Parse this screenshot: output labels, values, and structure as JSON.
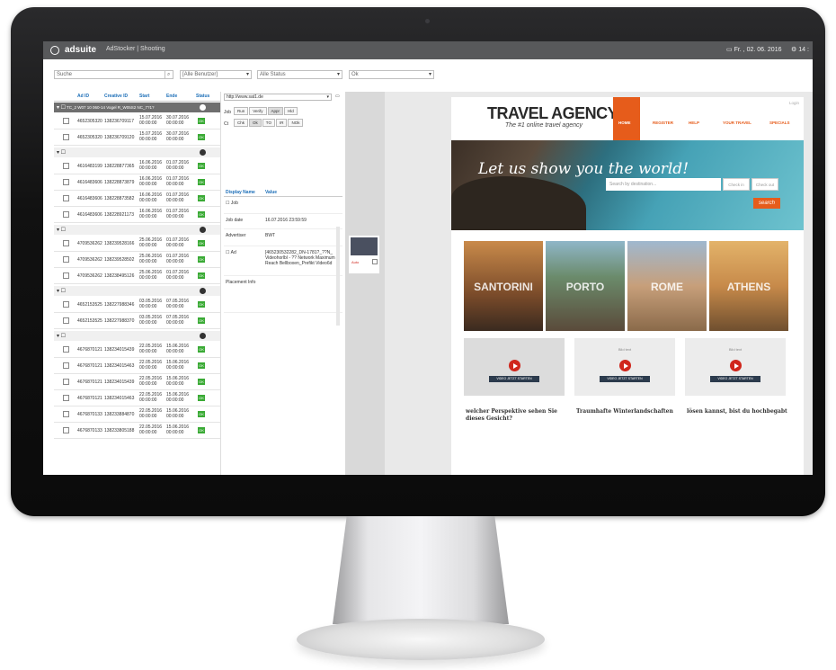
{
  "app": {
    "brand": "adsuite",
    "breadcrumb": "AdStocker | Shooting",
    "datetime": "Fr. , 02. 06. 2016",
    "user": "14 :"
  },
  "filters": {
    "search_placeholder": "Suche",
    "all_users": "[Alle Benutzer]",
    "all_status": "Alle Status",
    "ok_value": "Ok"
  },
  "grid": {
    "columns": [
      "Ad ID",
      "Creative ID",
      "Start",
      "Ende",
      "Status"
    ],
    "groups": [
      {
        "title": "TC_2 W07 10 060-14 Vogel R_W05S2 NC_7?1?",
        "dark": true,
        "rows": [
          {
            "ad": "4652305320",
            "creative": "138236709117",
            "start": "15.07.2016 00:00:00",
            "end": "30.07.2016 00:00:00",
            "status": "OK"
          },
          {
            "ad": "4652305320",
            "creative": "138236709120",
            "start": "15.07.2016 00:00:00",
            "end": "30.07.2016 00:00:00",
            "status": "OK"
          }
        ]
      },
      {
        "title": "",
        "dark": false,
        "rows": [
          {
            "ad": "4616483199",
            "creative": "138228877365",
            "start": "16.06.2016 00:00:00",
            "end": "01.07.2016 00:00:00",
            "status": "OK"
          },
          {
            "ad": "4616483606",
            "creative": "138228873879",
            "start": "16.06.2016 00:00:00",
            "end": "01.07.2016 00:00:00",
            "status": "OK"
          },
          {
            "ad": "4616483606",
            "creative": "138228873582",
            "start": "16.06.2016 00:00:00",
            "end": "01.07.2016 00:00:00",
            "status": "OK"
          },
          {
            "ad": "4616483606",
            "creative": "138228921173",
            "start": "16.06.2016 00:00:00",
            "end": "01.07.2016 00:00:00",
            "status": "OK"
          }
        ]
      },
      {
        "title": "",
        "dark": false,
        "rows": [
          {
            "ad": "4709536262",
            "creative": "138239528166",
            "start": "25.06.2016 00:00:00",
            "end": "01.07.2016 00:00:00",
            "status": "OK"
          },
          {
            "ad": "4709536262",
            "creative": "138239528502",
            "start": "25.06.2016 00:00:00",
            "end": "01.07.2016 00:00:00",
            "status": "OK"
          },
          {
            "ad": "4709536262",
            "creative": "138238495126",
            "start": "25.06.2016 00:00:00",
            "end": "01.07.2016 00:00:00",
            "status": "OK"
          }
        ]
      },
      {
        "title": "",
        "dark": false,
        "rows": [
          {
            "ad": "4652153525",
            "creative": "138227988346",
            "start": "03.05.2016 00:00:00",
            "end": "07.05.2016 00:00:00",
            "status": "OK"
          },
          {
            "ad": "4652153525",
            "creative": "138227988370",
            "start": "03.05.2016 00:00:00",
            "end": "07.05.2016 00:00:00",
            "status": "OK"
          }
        ]
      },
      {
        "title": "",
        "dark": false,
        "rows": [
          {
            "ad": "4676870121",
            "creative": "138234015439",
            "start": "22.05.2016 00:00:00",
            "end": "15.06.2016 00:00:00",
            "status": "OK"
          },
          {
            "ad": "4676870121",
            "creative": "138234015463",
            "start": "22.05.2016 00:00:00",
            "end": "15.06.2016 00:00:00",
            "status": "OK"
          },
          {
            "ad": "4676870121",
            "creative": "138234015439",
            "start": "22.05.2016 00:00:00",
            "end": "15.06.2016 00:00:00",
            "status": "OK"
          },
          {
            "ad": "4676870121",
            "creative": "138234015463",
            "start": "22.05.2016 00:00:00",
            "end": "15.06.2016 00:00:00",
            "status": "OK"
          },
          {
            "ad": "4676870133",
            "creative": "138233884870",
            "start": "22.05.2016 00:00:00",
            "end": "15.06.2016 00:00:00",
            "status": "OK"
          },
          {
            "ad": "4676870133",
            "creative": "138233805188",
            "start": "22.05.2016 00:00:00",
            "end": "15.06.2016 00:00:00",
            "status": "OK"
          }
        ]
      }
    ]
  },
  "detail": {
    "url": "http://www.sat1.de",
    "job_label": "Job",
    "job_buttons": [
      "Run",
      "Verify",
      "Appr",
      "Hld"
    ],
    "ct_label": "Ct",
    "ct_buttons": [
      "Chk",
      "Ok",
      "TO",
      "IR",
      "NOk"
    ],
    "col_name": "Display Name",
    "col_value": "Value",
    "rows": [
      {
        "k": "Job",
        "v": ""
      },
      {
        "k": "Job date",
        "v": "16.07.2016 23:59:59"
      },
      {
        "k": "Advertiser",
        "v": "BWT"
      },
      {
        "k": "Ad",
        "v": "[465230532282_DN-1781?_??N_ Videohorlbl - ?? Network Maximum Reach Bellboxen_Prefikt Video6d"
      },
      {
        "k": "Placement Info",
        "v": ""
      }
    ],
    "thumb_label": "Auto"
  },
  "preview": {
    "title": "TRAVEL AGENCY",
    "subtitle": "The #1 online travel agency",
    "login": "Login",
    "nav": [
      "HOME",
      "REGISTER",
      "HELP",
      "YOUR TRAVEL",
      "SPECIALS"
    ],
    "slogan": "Let us show you the world!",
    "search_placeholder": "Search by destination...",
    "checkin": "Check in",
    "checkout": "Check out",
    "search_btn": "search",
    "cities": [
      "SANTORINI",
      "PORTO",
      "ROME",
      "ATHENS"
    ],
    "video_top": "Bild text",
    "video_cta": "VIDEO JETZT STARTEN",
    "captions": [
      "welcher Perspektive sehen Sie dieses Gesicht?",
      "Traumhafte Winterlandschaften",
      "lösen kannst, bist du hochbegabt"
    ]
  }
}
